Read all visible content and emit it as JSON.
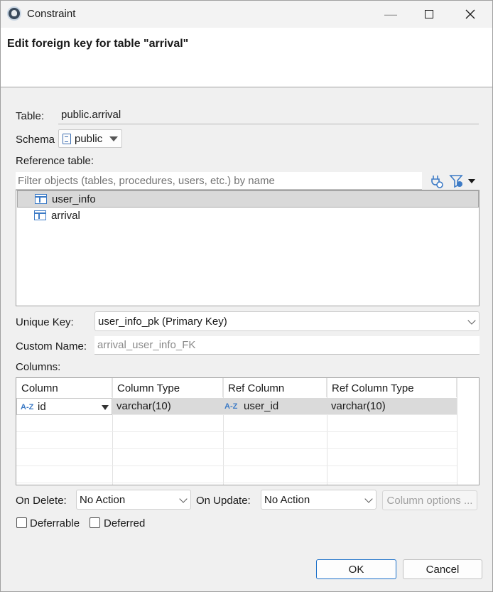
{
  "window": {
    "title": "Constraint"
  },
  "header": {
    "title": "Edit foreign key for table \"arrival\""
  },
  "form": {
    "table_label": "Table:",
    "table_value": "public.arrival",
    "schema_label": "Schema",
    "schema_value": "public",
    "reference_label": "Reference table:",
    "filter_placeholder": "Filter objects (tables, procedures, users, etc.) by name",
    "reference_tables": [
      "user_info",
      "arrival"
    ],
    "unique_key_label": "Unique Key:",
    "unique_key_value": "user_info_pk (Primary Key)",
    "custom_name_label": "Custom Name:",
    "custom_name_value": "arrival_user_info_FK",
    "columns_label": "Columns:"
  },
  "columns": {
    "headers": [
      "Column",
      "Column Type",
      "Ref Column",
      "Ref Column Type"
    ],
    "rows": [
      {
        "column": "id",
        "column_type": "varchar(10)",
        "ref_column": "user_id",
        "ref_column_type": "varchar(10)"
      }
    ]
  },
  "options": {
    "on_delete_label": "On Delete:",
    "on_delete_value": "No Action",
    "on_update_label": "On Update:",
    "on_update_value": "No Action",
    "column_options_label": "Column options ...",
    "deferrable_label": "Deferrable",
    "deferred_label": "Deferred"
  },
  "buttons": {
    "ok": "OK",
    "cancel": "Cancel"
  },
  "icons": {
    "az_badge": "A-Z",
    "accent": "#3d7bc6"
  }
}
